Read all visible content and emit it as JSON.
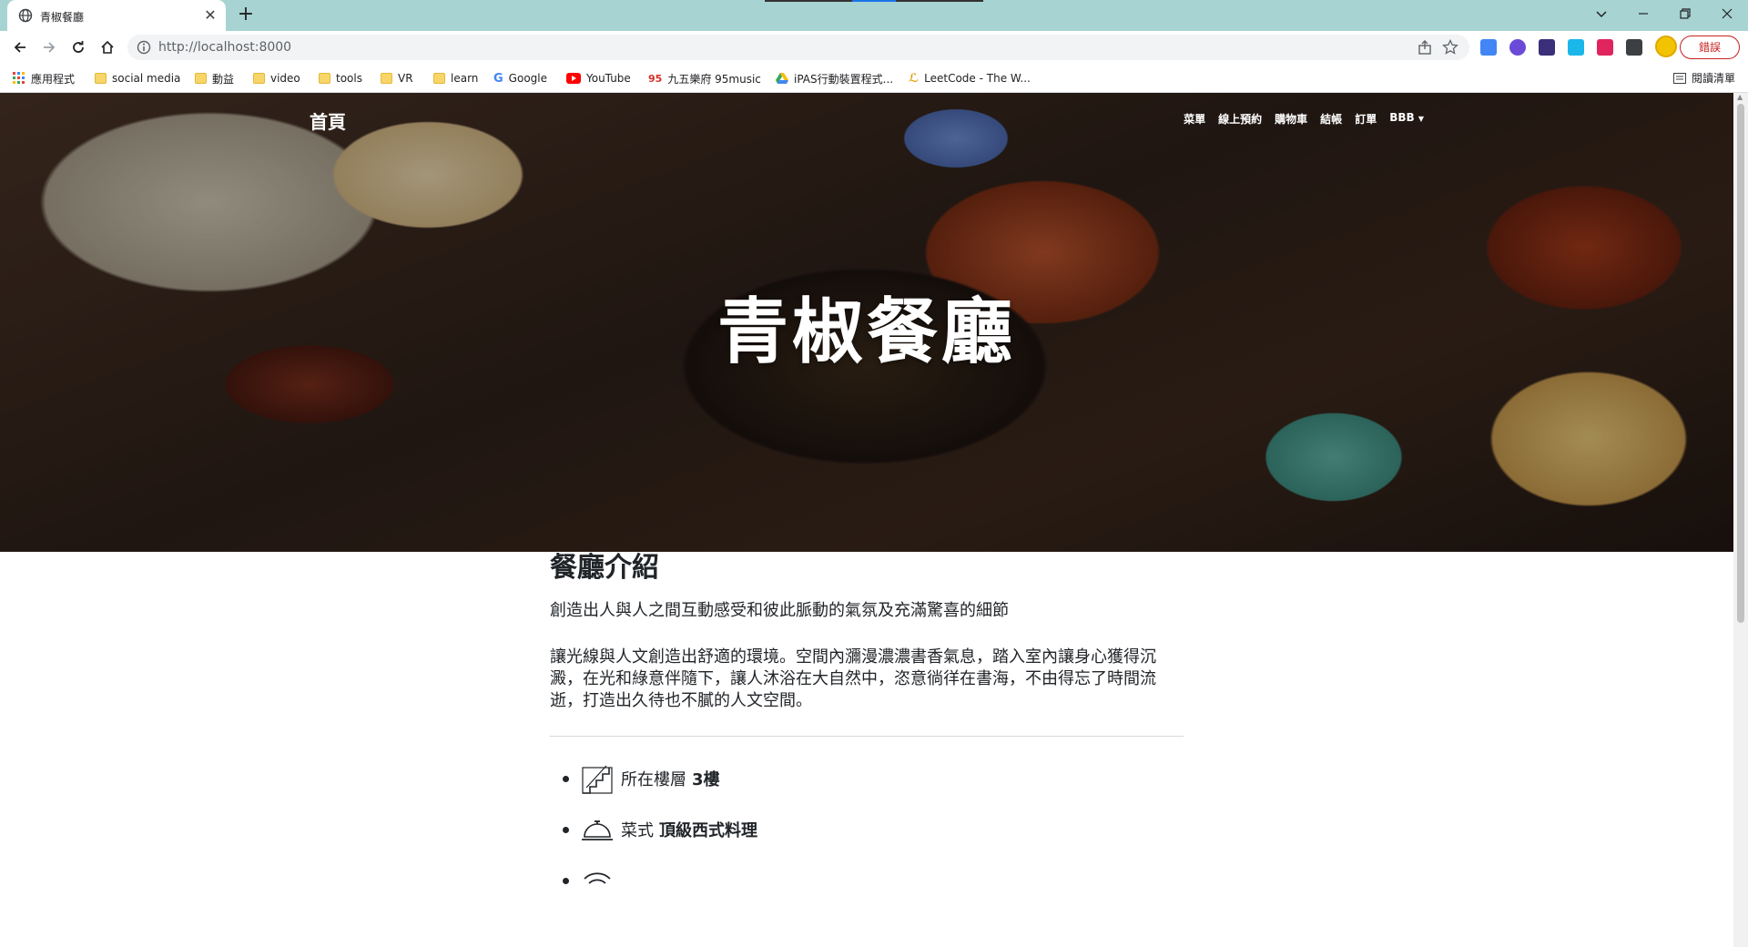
{
  "browser": {
    "tab_title": "青椒餐廳",
    "url": "http://localhost:8000",
    "error_label": "錯誤",
    "bookmarks": [
      {
        "label": "應用程式",
        "icon": "apps-grid-icon"
      },
      {
        "label": "social media",
        "icon": "folder-icon"
      },
      {
        "label": "動益",
        "icon": "folder-icon"
      },
      {
        "label": "video",
        "icon": "folder-icon"
      },
      {
        "label": "tools",
        "icon": "folder-icon"
      },
      {
        "label": "VR",
        "icon": "folder-icon"
      },
      {
        "label": "learn",
        "icon": "folder-icon"
      },
      {
        "label": "Google",
        "icon": "google-icon"
      },
      {
        "label": "YouTube",
        "icon": "youtube-icon"
      },
      {
        "label": "九五樂府 95music",
        "icon": "music-icon"
      },
      {
        "label": "iPAS行動裝置程式...",
        "icon": "drive-icon"
      },
      {
        "label": "LeetCode - The W...",
        "icon": "leetcode-icon"
      }
    ],
    "reading_list": "閱讀清單"
  },
  "navbar": {
    "brand": "首頁",
    "items": [
      "菜單",
      "線上預約",
      "購物車",
      "結帳",
      "訂單",
      "BBB"
    ]
  },
  "hero": {
    "title": "青椒餐廳"
  },
  "about": {
    "title": "餐廳介紹",
    "subtitle": "創造出人與人之間互動感受和彼此脈動的氣氛及充滿驚喜的細節",
    "body": "讓光線與人文創造出舒適的環境。空間內瀰漫濃濃書香氣息，踏入室內讓身心獲得沉澱，在光和綠意伴隨下，讓人沐浴在大自然中，恣意徜徉在書海，不由得忘了時間流逝，打造出久待也不膩的人文空間。",
    "features": [
      {
        "icon": "stairs-icon",
        "label": "所在樓層",
        "value": "3樓"
      },
      {
        "icon": "service-bell-icon",
        "label": "菜式",
        "value": "頂級西式料理"
      },
      {
        "icon": "wifi-icon",
        "label": "",
        "value": ""
      }
    ]
  },
  "colors": {
    "tabstrip": "#a7d4d2",
    "hero_text": "#ffffff",
    "body_text": "#212529"
  }
}
